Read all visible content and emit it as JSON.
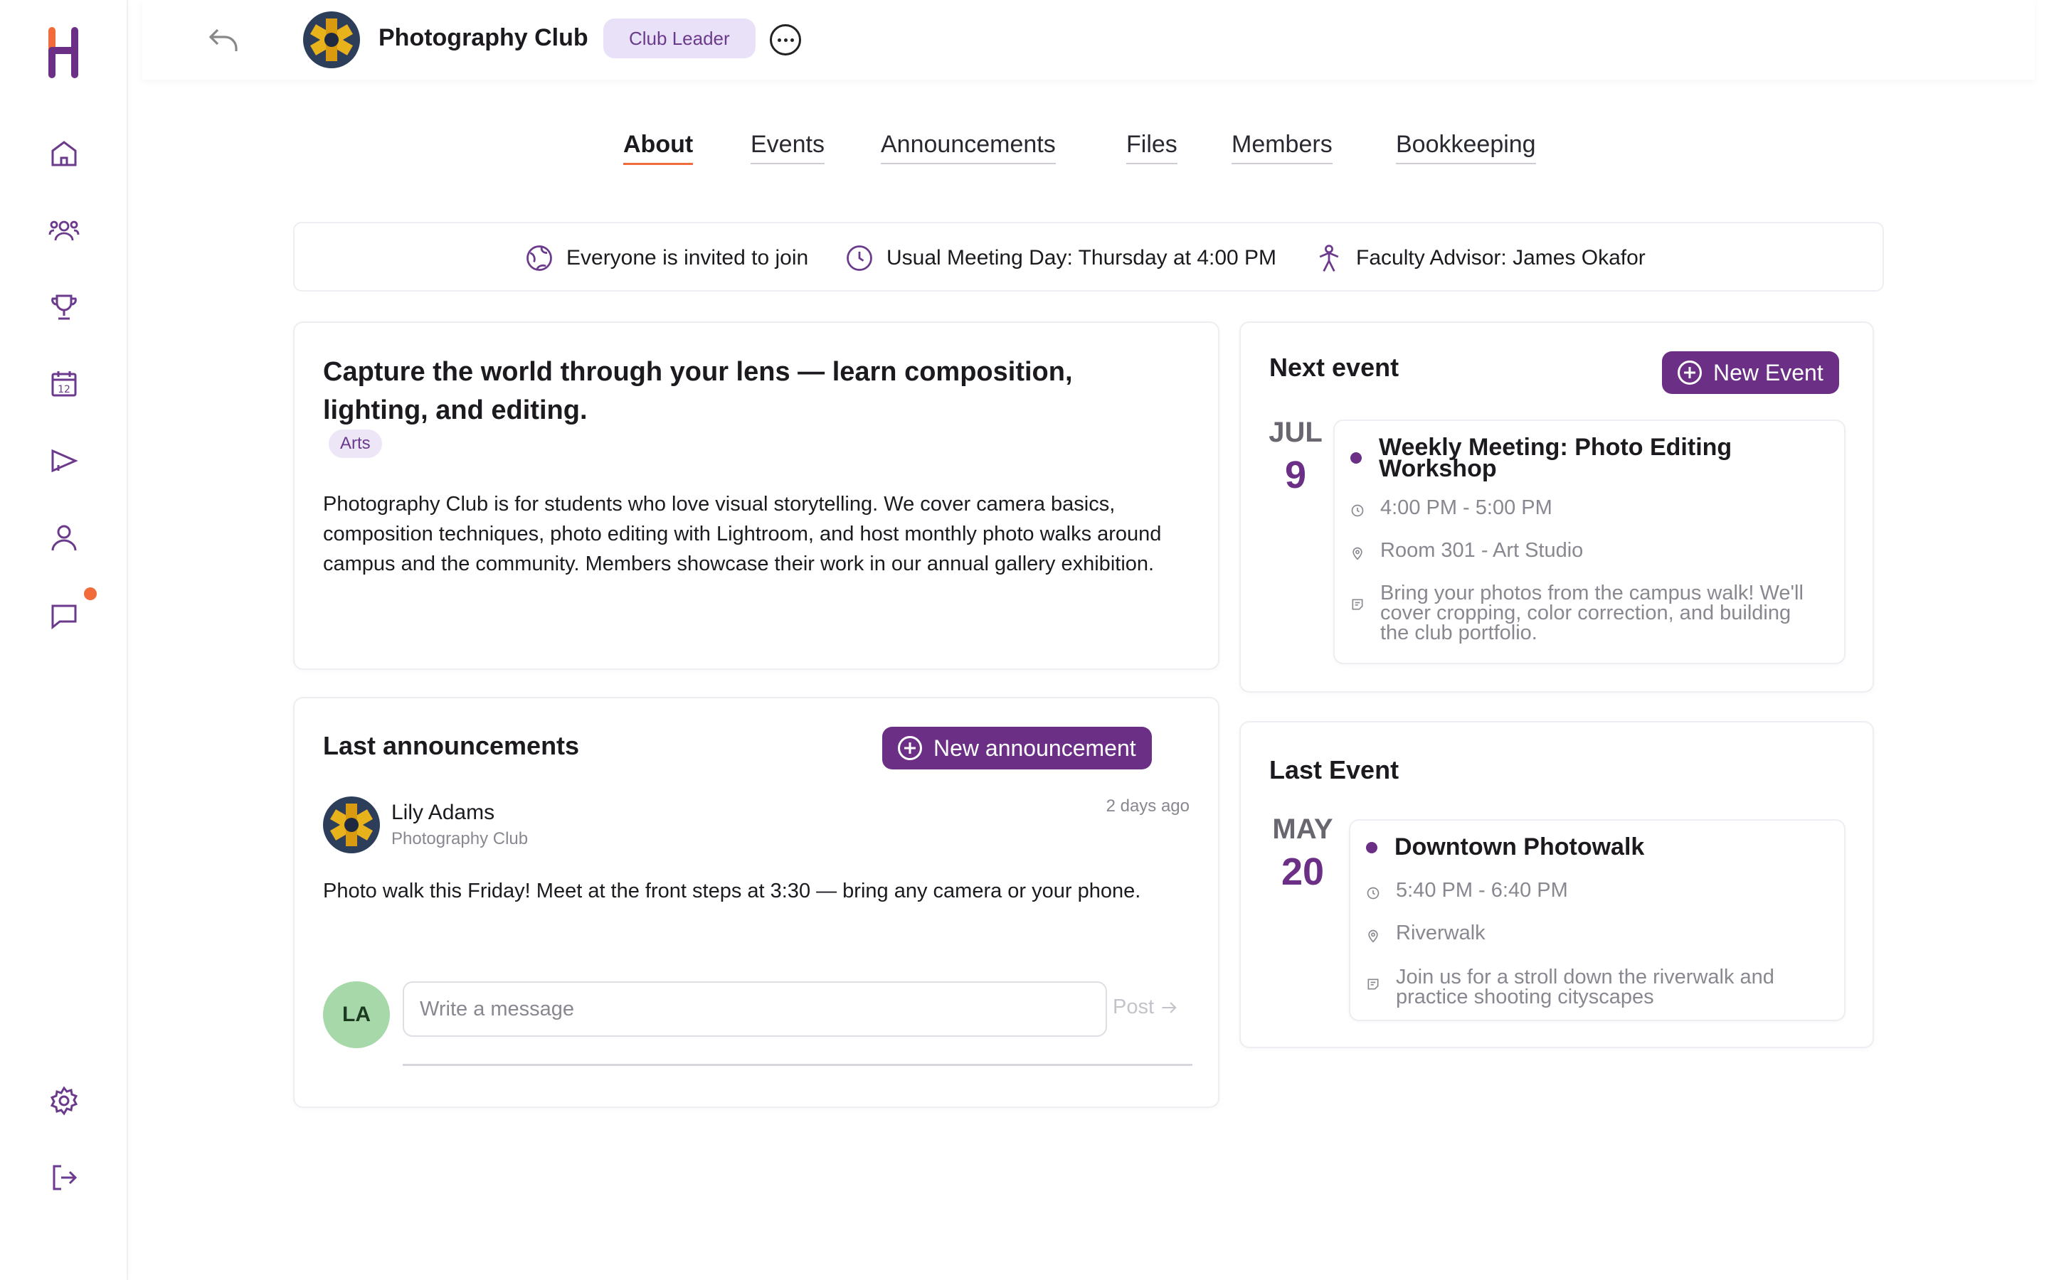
{
  "header": {
    "club_name": "Photography Club",
    "role_badge": "Club Leader"
  },
  "tabs": [
    {
      "label": "About",
      "active": true
    },
    {
      "label": "Events",
      "active": false
    },
    {
      "label": "Announcements",
      "active": false
    },
    {
      "label": "Files",
      "active": false
    },
    {
      "label": "Members",
      "active": false
    },
    {
      "label": "Bookkeeping",
      "active": false
    }
  ],
  "info_bar": {
    "invite": "Everyone is invited to join",
    "meeting": "Usual Meeting Day: Thursday at 4:00 PM",
    "advisor": "Faculty Advisor: James Okafor"
  },
  "about": {
    "tagline": "Capture the world through your lens — learn composition, lighting, and editing.",
    "category": "Arts",
    "description": "Photography Club is for students who love visual storytelling. We cover camera basics, composition techniques, photo editing with Lightroom, and host monthly photo walks around campus and the community. Members showcase their work in our annual gallery exhibition."
  },
  "announcements": {
    "title": "Last announcements",
    "new_button": "New announcement",
    "latest": {
      "author": "Lily Adams",
      "club": "Photography Club",
      "time": "2 days ago",
      "text": "Photo walk this Friday! Meet at the front steps at 3:30 — bring any camera or your phone."
    },
    "composer": {
      "initials": "LA",
      "placeholder": "Write a message",
      "post_label": "Post"
    }
  },
  "next_event": {
    "title": "Next event",
    "new_button": "New Event",
    "month": "JUL",
    "day": "9",
    "name": "Weekly Meeting: Photo Editing Workshop",
    "time": "4:00 PM - 5:00 PM",
    "location": "Room 301 - Art Studio",
    "description": "Bring your photos from the campus walk! We'll cover cropping, color correction, and building the club portfolio."
  },
  "last_event": {
    "title": "Last Event",
    "month": "MAY",
    "day": "20",
    "name": "Downtown Photowalk",
    "time": "5:40 PM - 6:40 PM",
    "location": "Riverwalk",
    "description": "Join us for a stroll down the riverwalk and practice shooting cityscapes"
  },
  "colors": {
    "brand": "#6b2f86",
    "accent": "#f26b3a",
    "badge_bg": "#e8e1f7"
  },
  "icons": {
    "sidebar": [
      "home-icon",
      "users-icon",
      "trophy-icon",
      "calendar-icon",
      "megaphone-icon",
      "profile-icon",
      "chat-icon",
      "settings-icon",
      "logout-icon"
    ]
  }
}
